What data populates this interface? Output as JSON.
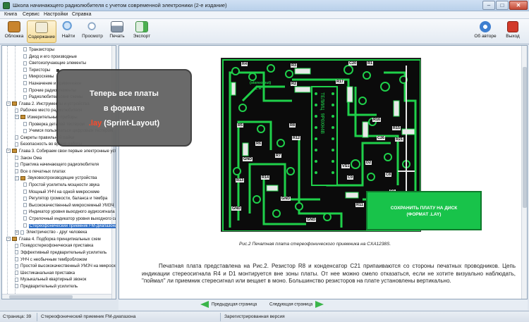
{
  "window": {
    "title": "Школа начинающего радиолюбителя с учетом современной электроники (2-е издание)"
  },
  "menu": [
    "Книга",
    "Сервис",
    "Настройки",
    "Справка"
  ],
  "toolbar": {
    "left": [
      {
        "label": "Обложка",
        "icon": "book-cover-icon",
        "color": "#c8842e"
      },
      {
        "label": "Содержание",
        "icon": "contents-icon",
        "color": "#e9e2c9"
      },
      {
        "label": "Найти",
        "icon": "find-icon",
        "color": "#6aa0d8"
      },
      {
        "label": "Просмотр",
        "icon": "preview-icon",
        "color": "#9cb9d9"
      },
      {
        "label": "Печать",
        "icon": "print-icon",
        "color": "#8796a8"
      },
      {
        "label": "Экспорт",
        "icon": "export-icon",
        "color": "#4caf50"
      }
    ],
    "right": [
      {
        "label": "Об авторе",
        "icon": "about-author-icon",
        "color": "#3f7fd0"
      },
      {
        "label": "Выход",
        "icon": "exit-icon",
        "color": "#d23a2a"
      }
    ]
  },
  "tree": [
    {
      "text": "Транзисторы",
      "level": 2,
      "kind": "doc"
    },
    {
      "text": "Диод и его производные",
      "level": 2,
      "kind": "doc"
    },
    {
      "text": "Светоизлучающие элементы",
      "level": 2,
      "kind": "doc"
    },
    {
      "text": "Тиристоры",
      "level": 2,
      "kind": "doc"
    },
    {
      "text": "Микросхемы",
      "level": 2,
      "kind": "doc"
    },
    {
      "text": "Назначение и применение",
      "level": 2,
      "kind": "doc"
    },
    {
      "text": "Прочие радиоэлементы",
      "level": 2,
      "kind": "doc"
    },
    {
      "text": "Радиолюбительские схемы",
      "level": 2,
      "kind": "doc"
    },
    {
      "text": "Глава 2. Инструменты и устройства",
      "level": 0,
      "kind": "book",
      "exp": "−"
    },
    {
      "text": "Рабочее место радиолюбителя",
      "level": 1,
      "kind": "doc"
    },
    {
      "text": "Измерительные приборы",
      "level": 1,
      "kind": "book",
      "exp": "−"
    },
    {
      "text": "Проверка деталей тестером",
      "level": 2,
      "kind": "doc"
    },
    {
      "text": "Учимся пользоваться цифровым тестером",
      "level": 2,
      "kind": "doc"
    },
    {
      "text": "Секреты правильной пайки",
      "level": 1,
      "kind": "doc"
    },
    {
      "text": "Безопасность во время работы",
      "level": 1,
      "kind": "doc"
    },
    {
      "text": "Глава 3. Собираем свои первые электронные устройства",
      "level": 0,
      "kind": "book",
      "exp": "−"
    },
    {
      "text": "Закон Ома",
      "level": 1,
      "kind": "doc"
    },
    {
      "text": "Практика начинающего радиолюбителя",
      "level": 1,
      "kind": "doc"
    },
    {
      "text": "Все о печатных платах",
      "level": 1,
      "kind": "doc"
    },
    {
      "text": "Звуковоспроизводящие устройства",
      "level": 1,
      "kind": "book",
      "exp": "−"
    },
    {
      "text": "Простой усилитель мощности звука",
      "level": 2,
      "kind": "doc"
    },
    {
      "text": "Мощный УНЧ на одной микросхеме",
      "level": 2,
      "kind": "doc"
    },
    {
      "text": "Регулятор громкости, баланса и тембра",
      "level": 2,
      "kind": "doc"
    },
    {
      "text": "Высококачественный микросхемный УМЗЧ",
      "level": 2,
      "kind": "doc"
    },
    {
      "text": "Индикатор уровня выходного аудиосигнала",
      "level": 2,
      "kind": "doc"
    },
    {
      "text": "Стрелочный индикатор уровня выходного сигнала",
      "level": 2,
      "kind": "doc"
    },
    {
      "text": "Стереофонический приемник FM-диапазона",
      "level": 2,
      "kind": "doc",
      "selected": true
    },
    {
      "text": "Электричество - друг человека",
      "level": 1,
      "kind": "doc",
      "exp": "+"
    },
    {
      "text": "Глава 4. Подборка принципиальных схем",
      "level": 0,
      "kind": "book",
      "exp": "−"
    },
    {
      "text": "Псевдостереофоническая приставка",
      "level": 1,
      "kind": "doc"
    },
    {
      "text": "Эффективный предварительный усилитель",
      "level": 1,
      "kind": "doc"
    },
    {
      "text": "УНЧ с необычным тембробложом",
      "level": 1,
      "kind": "doc"
    },
    {
      "text": "Простой высококачественный УМЗЧ на микросхеме",
      "level": 1,
      "kind": "doc"
    },
    {
      "text": "Шестиканальная приставка",
      "level": 1,
      "kind": "doc"
    },
    {
      "text": "Музыкальный квартирный звонок",
      "level": 1,
      "kind": "doc"
    },
    {
      "text": "Предварительный усилитель",
      "level": 1,
      "kind": "doc"
    }
  ],
  "callout": {
    "line1": "Теперь все платы",
    "line2": "в формате",
    "line3_highlight": ".lay",
    "line3_rest": " (Sprint-Layout)",
    "highlight_color": "#ff4a2a"
  },
  "pcb": {
    "chip_label": "ТЕЛИИЦ 9Р0ХН4В",
    "refs": [
      "R4",
      "R3",
      "R2",
      "R1",
      "C20",
      "R17",
      "R5",
      "R6",
      "R7",
      "R8",
      "R16",
      "R15",
      "R12",
      "R13",
      "R14",
      "C26",
      "R21",
      "D2",
      "D1",
      "GND",
      "GND",
      "GND",
      "GND",
      "VS1",
      "C9",
      "C8",
      "R11",
      "R10"
    ],
    "stereo_label": "(stereo out)",
    "lr_label": "L  R"
  },
  "save_button": {
    "line1": "СОХРАНИТЬ ПЛАТУ НА ДИСК",
    "line2": "(ФОРМАТ .LAY)"
  },
  "caption": "Рис.2 Печатная плата стереофонического приемника на CXA1238S.",
  "body_text": "Печатная плата представлена на Рис.2. Резистор R8 и конденсатор C21 припаиваются со стороны печатных проводников. Цепь индикации стереосигнала R4 и D1 монтируется вне зоны платы. От нее можно смело отказаться, если не хотите визуально наблюдать, \"поймал\" ли приемник стересигнал или вещает в моно. Большинство резисторов на плате установлены вертикально.",
  "nav": {
    "prev": "Предыдущая страница",
    "next": "Следующая страница"
  },
  "status": {
    "page": "Страница: 39",
    "section": "Стереофонический приемник FM-диапазона",
    "version": "Зарегистрированная версия"
  }
}
